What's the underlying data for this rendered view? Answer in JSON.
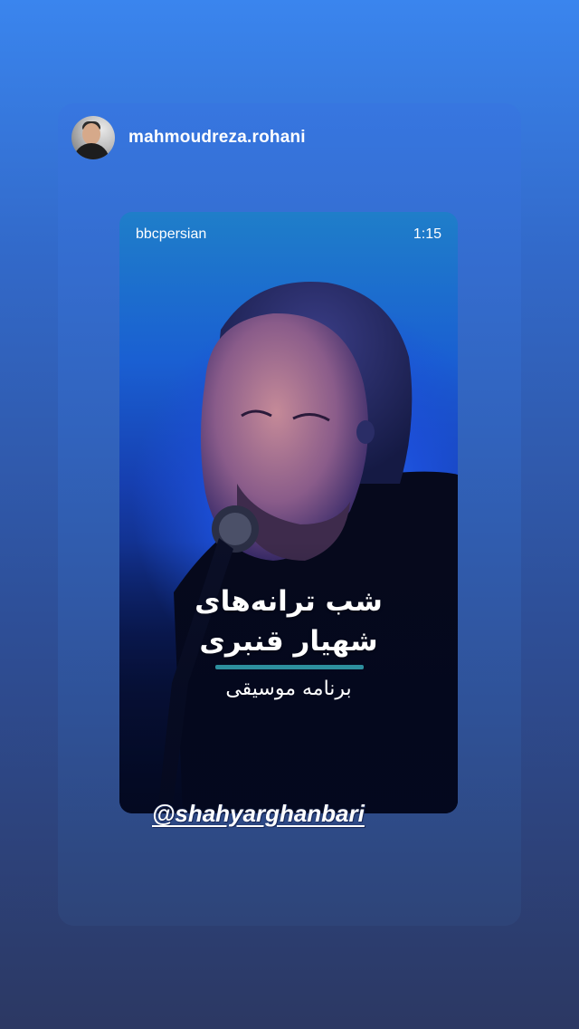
{
  "story": {
    "username": "mahmoudreza.rohani"
  },
  "reel": {
    "source": "bbcpersian",
    "duration": "1:15",
    "title_line1": "شب ترانه‌های",
    "title_line2": "شهیار قنبری",
    "subtitle": "برنامه موسیقی"
  },
  "mention": {
    "text": "@shahyarghanbari"
  },
  "colors": {
    "accent_divider": "#2d8f9e",
    "background_top": "#3a85ee",
    "background_bottom": "#2c3863"
  }
}
